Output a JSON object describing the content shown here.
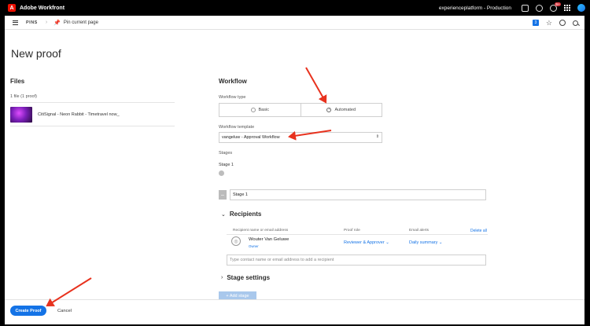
{
  "topbar": {
    "logo_letter": "A",
    "app_name": "Adobe Workfront",
    "org": "experienceplatform - Production",
    "notification_count": "9+"
  },
  "subnav": {
    "pins": "PINS",
    "pin_current_page": "Pin current page",
    "count_badge": "3"
  },
  "page": {
    "title": "New proof"
  },
  "files": {
    "heading": "Files",
    "count": "1 file (1 proof)",
    "items": [
      {
        "name": "CitiSignal - Neon Rabbit - Timetravel now_"
      }
    ]
  },
  "workflow": {
    "heading": "Workflow",
    "type_label": "Workflow type",
    "type_options": [
      "Basic",
      "Automated"
    ],
    "type_selected": "Automated",
    "template_label": "Workflow template",
    "template_value": "vangeluw - Approval Workflow",
    "stages_label": "Stages",
    "stage_step": "Stage 1",
    "stage_name_value": "Stage 1"
  },
  "recipients": {
    "heading": "Recipients",
    "columns": {
      "name": "Recipient name or email address",
      "role": "Proof role",
      "alerts": "Email alerts"
    },
    "delete_all": "Delete all",
    "rows": [
      {
        "name": "Wouter Van Geluwe",
        "tag": "Owner",
        "role": "Reviewer & Approver",
        "alerts": "Daily summary"
      }
    ],
    "input_placeholder": "Type contact name or email address to add a recipient"
  },
  "stage_settings": {
    "heading": "Stage settings"
  },
  "add_stage": "+ Add stage",
  "footer": {
    "create": "Create Proof",
    "cancel": "Cancel"
  },
  "colors": {
    "accent": "#1473e6",
    "arrow": "#e8321e",
    "topbar": "#000000"
  }
}
